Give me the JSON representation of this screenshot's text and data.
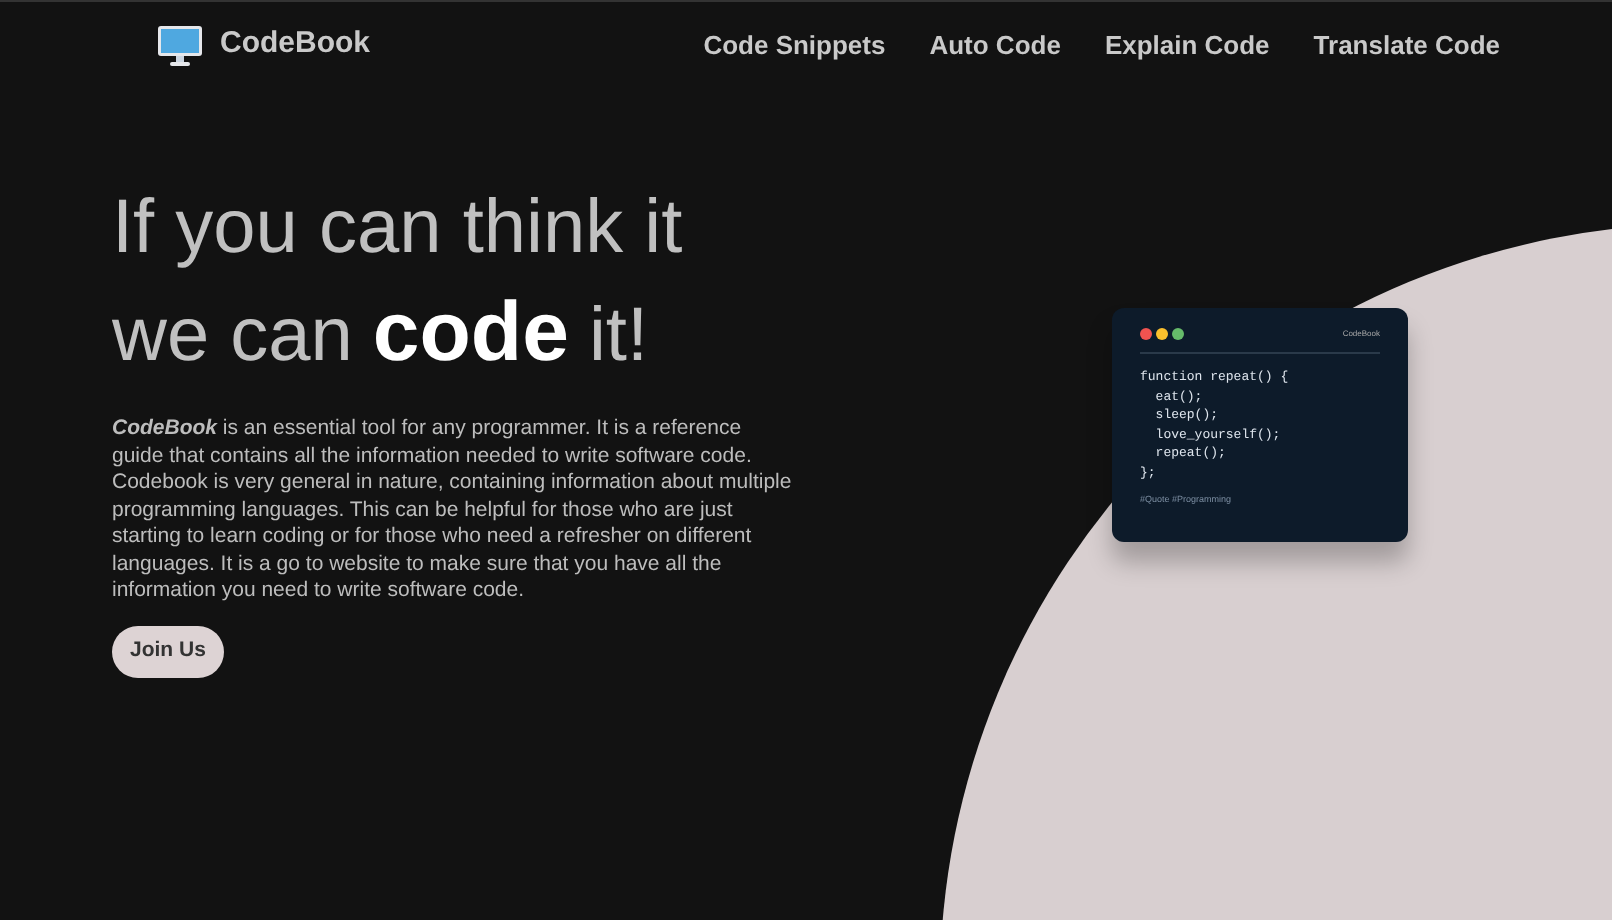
{
  "nav": {
    "brand": "CodeBook",
    "links": [
      "Code Snippets",
      "Auto Code",
      "Explain Code",
      "Translate Code"
    ]
  },
  "hero": {
    "line1": "If you can think it",
    "line2_start": "we can",
    "line2_emphasis": "code",
    "line2_end": "it!",
    "description": "**CodeBook** is an essential tool for any programmer. It is a reference guide that contains all the information needed to write software code. Codebook is very general in nature, containing information about multiple programming languages. This can be helpful for those who are just starting to learn coding or for those who need a refresher on different languages. It is a go to website to make sure that you have all the information you need to write software code.",
    "button": "Join Us"
  },
  "code_card": {
    "title": "CodeBook",
    "lines": [
      "function repeat() {",
      "  eat();",
      "  sleep();",
      "  love_yourself();",
      "  repeat();",
      "};"
    ],
    "tags": "#Quote #Programming"
  }
}
